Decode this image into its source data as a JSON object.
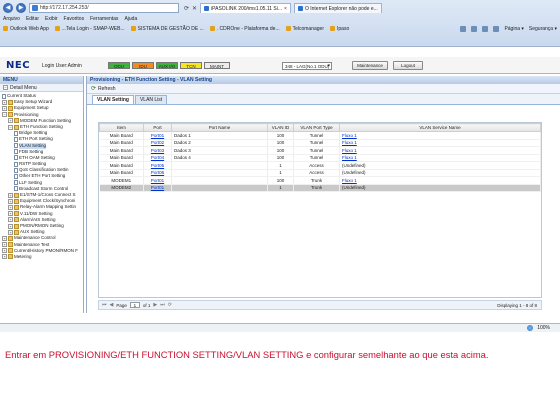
{
  "browser": {
    "url": "http://172.17.254.253/",
    "address_tools": [
      "⟳",
      "✕"
    ],
    "tabs": [
      {
        "label": "iPASOLINK 200/ims1.05.11 Si...",
        "close": "×",
        "active": true
      },
      {
        "label": "O Internet Explorer não pode e...",
        "close": "",
        "active": false
      }
    ],
    "menu": [
      "Arquivo",
      "Editar",
      "Exibir",
      "Favoritos",
      "Ferramentas",
      "Ajuda"
    ],
    "favorites": [
      "Outlook Web App",
      "...Tela Login - SMAP-WEB...",
      "SISTEMA DE GESTÃO DE ...",
      ". CDROne - Plataforma de...",
      "Telcomanager",
      "Ipaso"
    ],
    "cmd_page": "Página ▾",
    "cmd_security": "Segurança ▾"
  },
  "app": {
    "logo": "NEC",
    "login_user": "Login User:Admin",
    "alarms": [
      {
        "label": "ODU",
        "color": "#3bb43b"
      },
      {
        "label": "IDU",
        "color": "#f28c1e"
      },
      {
        "label": "AUX I/O",
        "color": "#3bb43b"
      },
      {
        "label": "TCN",
        "color": "#f5e61f"
      },
      {
        "label": "MAINT",
        "color": "#ececec"
      }
    ],
    "device": "348 - LAG(No.1 ODU)",
    "maintenance_label": "Maintenance",
    "logout_label": "Logout"
  },
  "left_menu": {
    "title": "MENU",
    "detail_menu": "Detail Menu",
    "items": [
      {
        "label": "Current Status",
        "level": 0,
        "exp": "",
        "icon": "page"
      },
      {
        "label": "Easy Setup Wizard",
        "level": 0,
        "exp": "+",
        "icon": "folder"
      },
      {
        "label": "Equipment Setup",
        "level": 0,
        "exp": "+",
        "icon": "folder"
      },
      {
        "label": "Provisioning",
        "level": 0,
        "exp": "−",
        "icon": "folder"
      },
      {
        "label": "MODEM Function Setting",
        "level": 1,
        "exp": "+",
        "icon": "folder"
      },
      {
        "label": "ETH Function Setting",
        "level": 1,
        "exp": "−",
        "icon": "folder"
      },
      {
        "label": "Bridge Setting",
        "level": 2,
        "exp": "",
        "icon": "page"
      },
      {
        "label": "ETH Port Setting",
        "level": 2,
        "exp": "",
        "icon": "page"
      },
      {
        "label": "VLAN Setting",
        "level": 2,
        "exp": "",
        "icon": "page",
        "selected": true
      },
      {
        "label": "FDB Setting",
        "level": 2,
        "exp": "",
        "icon": "page"
      },
      {
        "label": "ETH OAM Setting",
        "level": 2,
        "exp": "",
        "icon": "page"
      },
      {
        "label": "RSTP Setting",
        "level": 2,
        "exp": "",
        "icon": "page"
      },
      {
        "label": "QoS Classification Settin",
        "level": 2,
        "exp": "",
        "icon": "page"
      },
      {
        "label": "Other ETH Port Setting",
        "level": 2,
        "exp": "",
        "icon": "page"
      },
      {
        "label": "LLF Setting",
        "level": 2,
        "exp": "",
        "icon": "page"
      },
      {
        "label": "Broadcast Storm Control",
        "level": 2,
        "exp": "",
        "icon": "page"
      },
      {
        "label": "E1/STM-1/Cross Connect S",
        "level": 1,
        "exp": "+",
        "icon": "folder"
      },
      {
        "label": "Equipment Clock/Synchroni",
        "level": 1,
        "exp": "+",
        "icon": "folder"
      },
      {
        "label": "Relay-Alarm Mapping Settin",
        "level": 1,
        "exp": "+",
        "icon": "folder"
      },
      {
        "label": "V.11/DW Setting",
        "level": 1,
        "exp": "+",
        "icon": "folder"
      },
      {
        "label": "Alarm/AIS Setting",
        "level": 1,
        "exp": "+",
        "icon": "folder"
      },
      {
        "label": "PMON/RMON Setting",
        "level": 1,
        "exp": "+",
        "icon": "folder"
      },
      {
        "label": "AUX Setting",
        "level": 1,
        "exp": "+",
        "icon": "folder"
      },
      {
        "label": "Maintenance Control",
        "level": 0,
        "exp": "+",
        "icon": "folder"
      },
      {
        "label": "Maintenance Test",
        "level": 0,
        "exp": "+",
        "icon": "folder"
      },
      {
        "label": "Current/History PMON/RMON F",
        "level": 0,
        "exp": "+",
        "icon": "folder"
      },
      {
        "label": "Metering",
        "level": 0,
        "exp": "+",
        "icon": "folder"
      }
    ]
  },
  "content": {
    "title": "Provisioning - ETH Function Setting - VLAN Setting",
    "refresh_label": "Refresh",
    "tabs": [
      {
        "label": "VLAN Setting",
        "active": true
      },
      {
        "label": "VLAN List",
        "active": false
      }
    ],
    "table": {
      "headers": [
        "Item",
        "Port",
        "Port Name",
        "VLAN ID",
        "VLAN Port Type",
        "VLAN Service Name"
      ],
      "rows": [
        [
          "Main Board",
          "Port01",
          "Dados 1",
          "100",
          "Tunnel",
          "Fluxo 1",
          false
        ],
        [
          "Main Board",
          "Port02",
          "Dados 2",
          "100",
          "Tunnel",
          "Fluxo 1",
          false
        ],
        [
          "Main Board",
          "Port03",
          "Dados 3",
          "100",
          "Tunnel",
          "Fluxo 1",
          false
        ],
        [
          "Main Board",
          "Port04",
          "Dados 4",
          "100",
          "Tunnel",
          "Fluxo 1",
          false
        ],
        [
          "Main Board",
          "Port05",
          "",
          "1",
          "Access",
          "(Undefined)",
          false
        ],
        [
          "Main Board",
          "Port06",
          "",
          "1",
          "Access",
          "(Undefined)",
          false
        ],
        [
          "MODEM1",
          "Port01",
          "",
          "100",
          "Trunk",
          "Fluxo 1",
          false
        ],
        [
          "MODEM2",
          "Port01",
          "",
          "1",
          "Trunk",
          "(Undefined)",
          true
        ]
      ]
    },
    "pager": {
      "first": "⏮",
      "prev": "◀",
      "page_label": "Page",
      "page_value": "1",
      "of_label": "of 1",
      "next": "▶",
      "last": "⏭",
      "refresh": "⟳",
      "count": "Displaying 1 - 8 of 8"
    }
  },
  "status_bar": {
    "zoom": "100%"
  },
  "caption": "Entrar em PROVISIONING/ETH FUNCTION SETTING/VLAN SETTING e configurar semelhante ao que esta acima."
}
